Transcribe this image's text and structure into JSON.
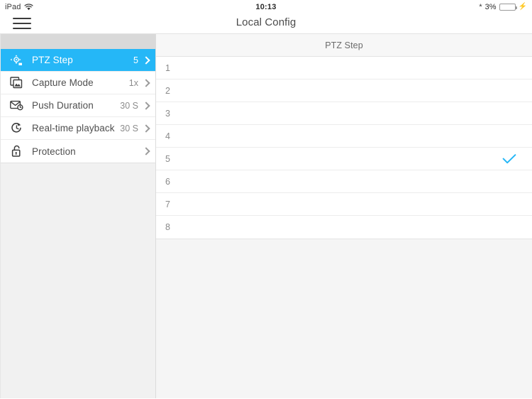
{
  "status_bar": {
    "device": "iPad",
    "wifi_icon": "wifi-icon",
    "time": "10:13",
    "bluetooth_icon": "bluetooth-icon",
    "battery_percent": "3%",
    "battery_level": 3,
    "charging_icon": "charging-bolt-icon",
    "battery_color": "#e8453c"
  },
  "nav_bar": {
    "menu_icon": "hamburger-menu-icon",
    "title": "Local Config"
  },
  "theme": {
    "accent": "#25b7f7",
    "text": "#4f4f4f",
    "muted": "#8a8a8a"
  },
  "sidebar": {
    "items": [
      {
        "icon": "ptz-joystick-icon",
        "label": "PTZ Step",
        "value": "5",
        "selected": true
      },
      {
        "icon": "capture-photos-icon",
        "label": "Capture Mode",
        "value": "1x",
        "selected": false
      },
      {
        "icon": "mail-clock-icon",
        "label": "Push Duration",
        "value": "30 S",
        "selected": false
      },
      {
        "icon": "replay-clock-icon",
        "label": "Real-time playback",
        "value": "30 S",
        "selected": false
      },
      {
        "icon": "unlock-padlock-icon",
        "label": "Protection",
        "value": "",
        "selected": false
      }
    ]
  },
  "panel": {
    "header_title": "PTZ Step",
    "selected_value": "5",
    "check_icon": "checkmark-icon",
    "options": [
      {
        "label": "1",
        "checked": false
      },
      {
        "label": "2",
        "checked": false
      },
      {
        "label": "3",
        "checked": false
      },
      {
        "label": "4",
        "checked": false
      },
      {
        "label": "5",
        "checked": true
      },
      {
        "label": "6",
        "checked": false
      },
      {
        "label": "7",
        "checked": false
      },
      {
        "label": "8",
        "checked": false
      }
    ]
  }
}
